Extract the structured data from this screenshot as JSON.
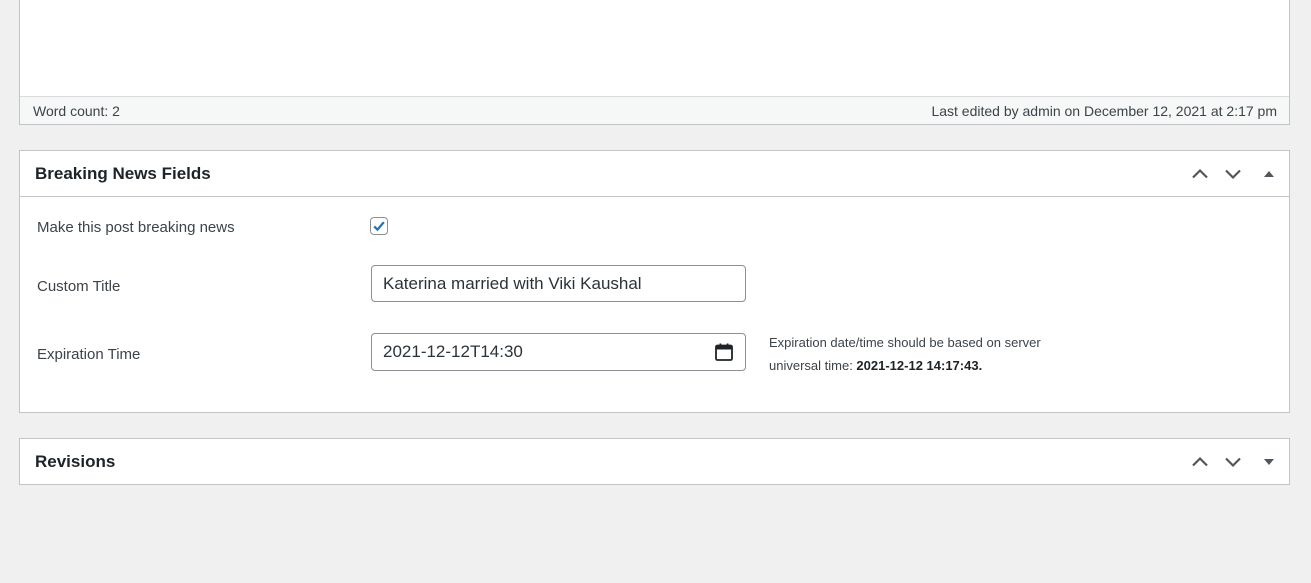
{
  "editor": {
    "word_count": "Word count: 2",
    "last_edited": "Last edited by admin on December 12, 2021 at 2:17 pm"
  },
  "breaking_news": {
    "title": "Breaking News Fields",
    "fields": {
      "breaking_label": "Make this post breaking news",
      "breaking_checked": true,
      "custom_title_label": "Custom Title",
      "custom_title_value": "Katerina married with Viki Kaushal",
      "expiration_label": "Expiration Time",
      "expiration_value": "2021-12-12T14:30",
      "help_prefix": "Expiration date/time should be based on server universal time: ",
      "help_time": "2021-12-12 14:17:43."
    }
  },
  "revisions": {
    "title": "Revisions"
  },
  "icons": {
    "move_up": "chevron-up-icon",
    "move_down": "chevron-down-icon",
    "collapse": "triangle-up-icon",
    "expand": "triangle-down-icon",
    "calendar": "calendar-icon",
    "check": "checkmark-icon"
  },
  "colors": {
    "accent": "#2271b1",
    "background": "#f0f0f1",
    "border": "#c3c4c7"
  }
}
